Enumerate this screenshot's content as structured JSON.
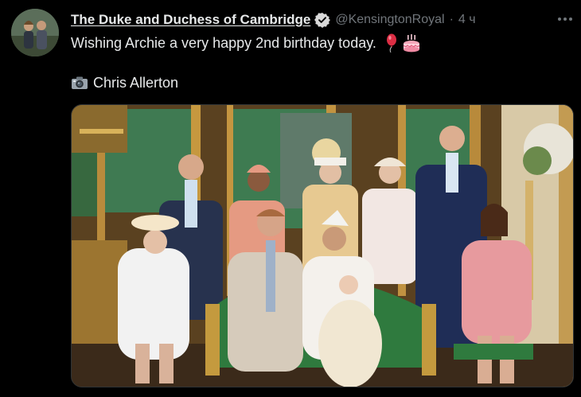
{
  "tweet": {
    "author_name": "The Duke and Duchess of Cambridge",
    "handle": "@KensingtonRoyal",
    "separator": "·",
    "time": "4 ч",
    "text": "Wishing Archie a very happy 2nd birthday today.",
    "photo_credit": "Chris Allerton",
    "icons": {
      "verified": "verified-badge-icon",
      "more": "more-options-icon",
      "balloon": "balloon-emoji",
      "cake": "birthday-cake-emoji",
      "camera": "camera-emoji"
    }
  },
  "colors": {
    "background": "#000000",
    "text_primary": "#e7e9ea",
    "text_secondary": "#71767b",
    "border": "#2f3336"
  }
}
